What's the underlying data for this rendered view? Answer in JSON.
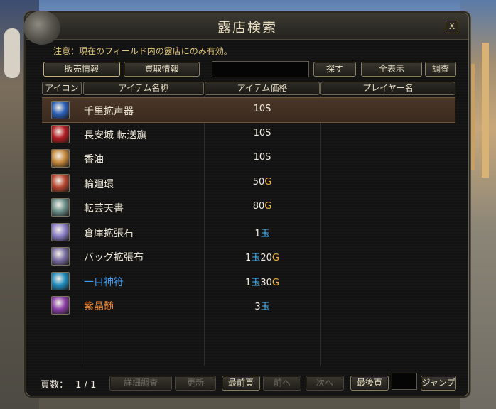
{
  "window": {
    "title": "露店検索",
    "close_label": "X",
    "notice": "注意：現在のフィールド内の露店にのみ有効。"
  },
  "toolbar": {
    "sell_info": "販売情報",
    "buy_info": "買取情報",
    "search": "探す",
    "show_all": "全表示",
    "investigate": "調査"
  },
  "columns": {
    "icon": "アイコン",
    "item_name": "アイテム名称",
    "item_price": "アイテム価格",
    "player_name": "プレイヤー名"
  },
  "items": [
    {
      "name": "千里拡声器",
      "name_color": "#ece6d6",
      "price_parts": [
        {
          "t": "10S",
          "c": "s"
        }
      ],
      "icon": "scroll-icon",
      "selected": true
    },
    {
      "name": "長安城 転送旗",
      "name_color": "#ece6d6",
      "price_parts": [
        {
          "t": "10S",
          "c": "s"
        }
      ],
      "icon": "flag-icon",
      "selected": false
    },
    {
      "name": "香油",
      "name_color": "#ece6d6",
      "price_parts": [
        {
          "t": "10S",
          "c": "s"
        }
      ],
      "icon": "oil-jar-icon",
      "selected": false
    },
    {
      "name": "輪廻環",
      "name_color": "#ece6d6",
      "price_parts": [
        {
          "t": "50",
          "c": "num"
        },
        {
          "t": "G",
          "c": "g"
        }
      ],
      "icon": "ring-icon",
      "selected": false
    },
    {
      "name": "転芸天書",
      "name_color": "#ece6d6",
      "price_parts": [
        {
          "t": "80",
          "c": "num"
        },
        {
          "t": "G",
          "c": "g"
        }
      ],
      "icon": "book-icon",
      "selected": false
    },
    {
      "name": "倉庫拡張石",
      "name_color": "#ece6d6",
      "price_parts": [
        {
          "t": "1",
          "c": "num"
        },
        {
          "t": "玉",
          "c": "jade"
        }
      ],
      "icon": "gem-stone-icon",
      "selected": false
    },
    {
      "name": "バッグ拡張布",
      "name_color": "#ece6d6",
      "price_parts": [
        {
          "t": "1",
          "c": "num"
        },
        {
          "t": "玉",
          "c": "jade"
        },
        {
          "t": "20",
          "c": "num"
        },
        {
          "t": "G",
          "c": "g"
        }
      ],
      "icon": "cloth-icon",
      "selected": false
    },
    {
      "name": "一目神符",
      "name_color": "#3f9ef0",
      "price_parts": [
        {
          "t": "1",
          "c": "num"
        },
        {
          "t": "玉",
          "c": "jade"
        },
        {
          "t": "30",
          "c": "num"
        },
        {
          "t": "G",
          "c": "g"
        }
      ],
      "icon": "talisman-icon",
      "selected": false
    },
    {
      "name": "紫晶髄",
      "name_color": "#f08a35",
      "price_parts": [
        {
          "t": "3",
          "c": "num"
        },
        {
          "t": "玉",
          "c": "jade"
        }
      ],
      "icon": "crystal-icon",
      "selected": false
    }
  ],
  "pagination": {
    "label": "頁数：",
    "value": "1 / 1",
    "detail": "詳細調査",
    "refresh": "更新",
    "first": "最前頁",
    "prev": "前へ",
    "next": "次へ",
    "last": "最後頁",
    "jump": "ジャンプ"
  },
  "icon_colors": {
    "scroll-icon": "#2a5fb8",
    "flag-icon": "#b21b22",
    "oil-jar-icon": "#c7883a",
    "ring-icon": "#b7452f",
    "book-icon": "#6a8f8a",
    "gem-stone-icon": "#8a7fc9",
    "cloth-icon": "#7a6fa5",
    "talisman-icon": "#1f8cc0",
    "crystal-icon": "#8a3ea8"
  }
}
